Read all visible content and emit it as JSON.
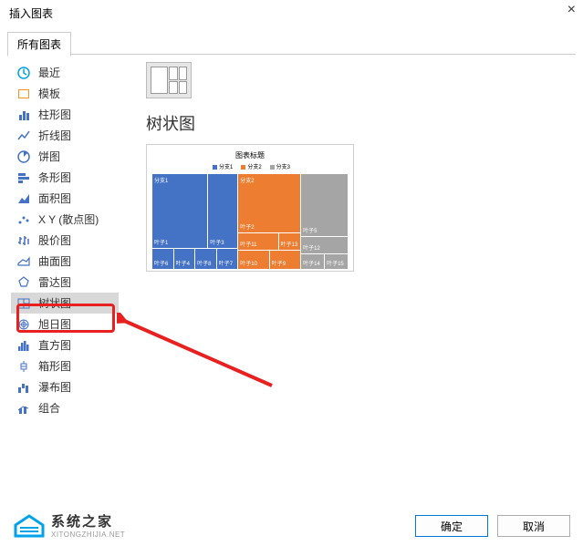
{
  "dialog": {
    "title": "插入图表"
  },
  "tab": {
    "label": "所有图表"
  },
  "sidebar": {
    "items": [
      {
        "label": "最近",
        "icon": "recent"
      },
      {
        "label": "模板",
        "icon": "template"
      },
      {
        "label": "柱形图",
        "icon": "column"
      },
      {
        "label": "折线图",
        "icon": "line"
      },
      {
        "label": "饼图",
        "icon": "pie"
      },
      {
        "label": "条形图",
        "icon": "bar"
      },
      {
        "label": "面积图",
        "icon": "area"
      },
      {
        "label": "X Y (散点图)",
        "icon": "scatter"
      },
      {
        "label": "股价图",
        "icon": "stock"
      },
      {
        "label": "曲面图",
        "icon": "surface"
      },
      {
        "label": "雷达图",
        "icon": "radar"
      },
      {
        "label": "树状图",
        "icon": "treemap"
      },
      {
        "label": "旭日图",
        "icon": "sunburst"
      },
      {
        "label": "直方图",
        "icon": "histogram"
      },
      {
        "label": "箱形图",
        "icon": "box"
      },
      {
        "label": "瀑布图",
        "icon": "waterfall"
      },
      {
        "label": "组合",
        "icon": "combo"
      }
    ],
    "selected_index": 11
  },
  "main": {
    "heading": "树状图"
  },
  "chart_data": {
    "type": "treemap",
    "title": "图表标题",
    "legend": [
      {
        "name": "分支1",
        "color": "#4472c4"
      },
      {
        "name": "分支2",
        "color": "#ed7d31"
      },
      {
        "name": "分支3",
        "color": "#a5a5a5"
      }
    ],
    "series": [
      {
        "branch": "分支1",
        "items": [
          {
            "label": "叶子1",
            "value": 22
          },
          {
            "label": "叶子3",
            "value": 10
          },
          {
            "label": "叶子6",
            "value": 5
          },
          {
            "label": "叶子4",
            "value": 5
          },
          {
            "label": "叶子8",
            "value": 5
          },
          {
            "label": "叶子7",
            "value": 4
          }
        ]
      },
      {
        "branch": "分支2",
        "items": [
          {
            "label": "叶子2",
            "value": 14
          },
          {
            "label": "叶子11",
            "value": 6
          },
          {
            "label": "叶子13",
            "value": 4
          },
          {
            "label": "叶子10",
            "value": 3
          },
          {
            "label": "叶子9",
            "value": 3
          }
        ]
      },
      {
        "branch": "分支3",
        "items": [
          {
            "label": "叶子5",
            "value": 10
          },
          {
            "label": "叶子12",
            "value": 5
          },
          {
            "label": "叶子14",
            "value": 3
          },
          {
            "label": "叶子15",
            "value": 2
          }
        ]
      }
    ]
  },
  "buttons": {
    "ok": "确定",
    "cancel": "取消"
  },
  "watermark": {
    "line1": "系统之家",
    "line2": "XITONGZHIJIA.NET"
  },
  "icon_colors": {
    "recent": "#00a2e8",
    "template": "#f7931e",
    "column": "#4472c4",
    "line": "#4472c4",
    "pie": "#4472c4",
    "bar": "#4472c4",
    "area": "#4472c4",
    "scatter": "#4472c4",
    "stock": "#4472c4",
    "surface": "#4472c4",
    "radar": "#4472c4",
    "treemap": "#4472c4",
    "sunburst": "#4472c4",
    "histogram": "#4472c4",
    "box": "#4472c4",
    "waterfall": "#4472c4",
    "combo": "#4472c4"
  }
}
